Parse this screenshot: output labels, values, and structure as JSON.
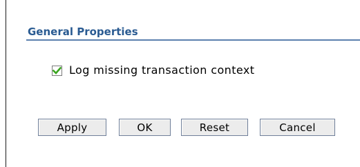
{
  "section": {
    "title": "General Properties"
  },
  "options": {
    "log_missing_context": {
      "label": "Log missing transaction context",
      "checked": true,
      "check_color": "#3aa51f"
    }
  },
  "buttons": {
    "apply": "Apply",
    "ok": "OK",
    "reset": "Reset",
    "cancel": "Cancel"
  },
  "colors": {
    "title": "#2a5b92",
    "title_rule": "#5b7fae",
    "button_face": "#ececec",
    "button_border": "#6f7f99"
  }
}
